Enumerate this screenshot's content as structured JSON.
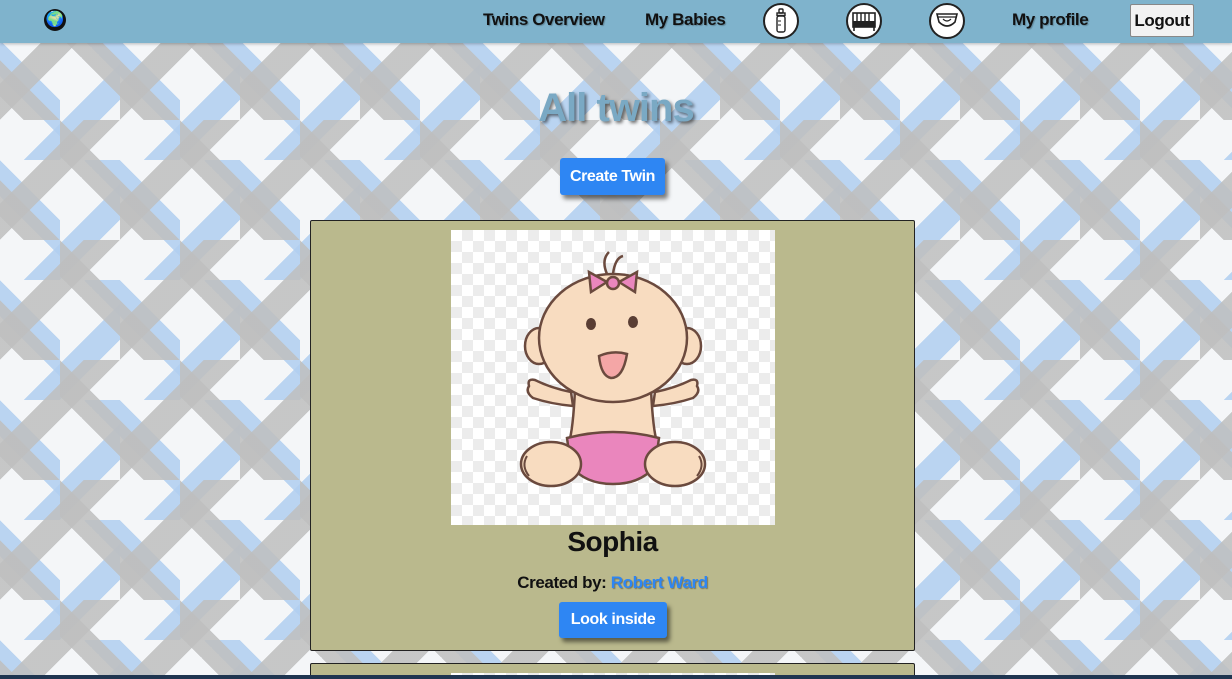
{
  "nav": {
    "links": [
      "Twins Overview",
      "My Babies",
      "My profile"
    ],
    "icons": [
      "globe-icon",
      "bottle-icon",
      "crib-icon",
      "diaper-icon"
    ],
    "logout_label": "Logout"
  },
  "main": {
    "title": "All twins",
    "create_label": "Create Twin"
  },
  "twins": [
    {
      "name": "Sophia",
      "created_by_label": "Created by:",
      "creator": "Robert Ward",
      "look_label": "Look inside"
    }
  ],
  "colors": {
    "navbar": "#7fb3cc",
    "accent_button": "#2e86f3",
    "card_background": "#bab98d",
    "title": "#7aa9c4"
  }
}
